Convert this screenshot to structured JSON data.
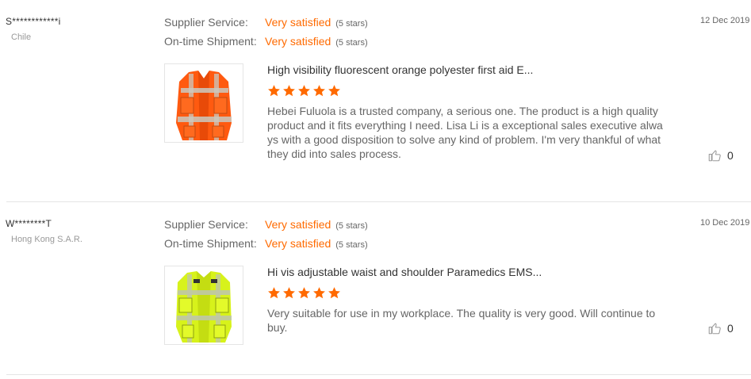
{
  "labels": {
    "supplier_service": "Supplier Service:",
    "on_time_shipment": "On-time Shipment:"
  },
  "colors": {
    "accent": "#ff6a00",
    "star": "#ff6a00",
    "muted": "#999999",
    "divider": "#e5e5e5"
  },
  "reviews": [
    {
      "reviewer": "S************i",
      "country": "Chile",
      "supplier_service": {
        "value": "Very satisfied",
        "note": "(5 stars)"
      },
      "on_time_shipment": {
        "value": "Very satisfied",
        "note": "(5 stars)"
      },
      "date": "12 Dec 2019",
      "product_title": "High visibility fluorescent orange polyester first aid E...",
      "product_image": "orange-safety-vest",
      "rating": 5,
      "text": "Hebei Fuluola is a trusted company, a serious one. The product is a high quality product and it fits everything I need. Lisa Li is a exceptional sales executive always with a good disposition to solve any kind of problem. I'm very thankful of what they did into sales process.",
      "likes": "0",
      "like_icon": "thumbs-up-icon"
    },
    {
      "reviewer": "W********T",
      "country": "Hong Kong S.A.R.",
      "supplier_service": {
        "value": "Very satisfied",
        "note": "(5 stars)"
      },
      "on_time_shipment": {
        "value": "Very satisfied",
        "note": "(5 stars)"
      },
      "date": "10 Dec 2019",
      "product_title": "Hi vis adjustable waist and shoulder Paramedics EMS...",
      "product_image": "yellow-safety-vest",
      "rating": 5,
      "text": "Very suitable for use in my workplace. The quality is very good. Will continue to buy.",
      "likes": "0",
      "like_icon": "thumbs-up-icon"
    }
  ]
}
